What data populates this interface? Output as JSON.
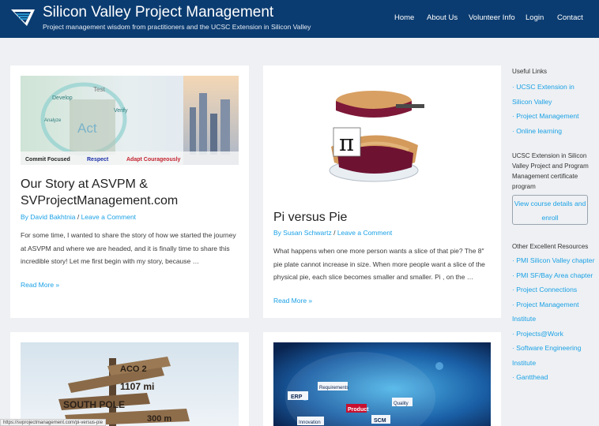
{
  "header": {
    "title": "Silicon Valley Project Management",
    "tagline": "Project management wisdom from practitioners and the UCSC Extension in Silicon Valley",
    "nav": [
      "Home",
      "About Us",
      "Volunteer Info",
      "Login",
      "Contact"
    ]
  },
  "posts": [
    {
      "image_labels": [
        "Commit Focused",
        "Respect",
        "Adapt Courageously"
      ],
      "image_words": [
        "Test",
        "Develop",
        "Verify",
        "Analyze",
        "Act"
      ],
      "title": "Our Story at ASVPM & SVProjectManagement.com",
      "author": "By David Bakhtnia",
      "separator": "/",
      "comment": "Leave a Comment",
      "excerpt": "For some time, I wanted to share the story of how we started the journey at ASVPM and where we are headed, and it is finally time to share this incredible story! Let me first begin with my story, because …",
      "read_more": "Read More »"
    },
    {
      "image_symbol": "π",
      "title": "Pi versus Pie",
      "author": "By Susan Schwartz",
      "separator": "/",
      "comment": "Leave a Comment",
      "excerpt": "What happens when one more person wants a slice of that pie? The 8″ pie plate cannot increase in size.  When more people want a slice of the physical pie, each slice becomes smaller and smaller. Pi , on the …",
      "read_more": "Read More »"
    },
    {
      "image_signs": [
        "ACO 2",
        "SOUTH POLE",
        "1107 mi",
        "300 m"
      ]
    },
    {
      "image_words": [
        "ERP",
        "Product",
        "SCM",
        "Quality",
        "Innovation",
        "Requirements"
      ]
    }
  ],
  "sidebar": {
    "useful_links_heading": "Useful Links",
    "useful_links": [
      "· UCSC Extension in Silicon Valley",
      "· Project Management",
      "· Online learning"
    ],
    "ucsc_text": "UCSC Extension in Silicon Valley Project and Program Management certificate program",
    "button_label": "View course details and enroll",
    "other_heading": "Other Excellent Resources",
    "other_links": [
      "· PMI Silicon Valley chapter",
      "· PMI SF/Bay Area chapter",
      "· Project Connections",
      "· Project Management Institute",
      "· Projects@Work",
      "· Software Engineering Institute",
      "· Gantthead"
    ]
  },
  "status_bar": "https://svprojectmanagement.com/pi-versus-pie",
  "colors": {
    "header_bg": "#0b3c71",
    "link": "#1aa1e6",
    "page_bg": "#eef0f3"
  }
}
